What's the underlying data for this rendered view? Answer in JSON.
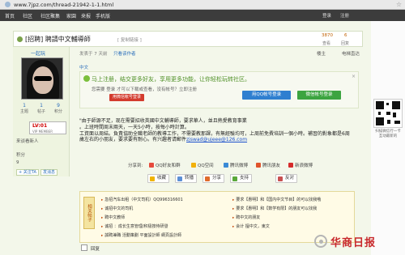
{
  "browser": {
    "url": "www.7jpz.com/thread-21942-1-1.html"
  },
  "sitenav": {
    "items": [
      "首页",
      "社区",
      "社区聚集",
      "家園",
      "来报",
      "手机版"
    ],
    "right": [
      "登录",
      "注册"
    ]
  },
  "thread": {
    "title": "[招聘] 聘請中文輔導師",
    "subtitle": "[ 复制链接 ]",
    "stats": [
      {
        "value": "3870",
        "label": "查看"
      },
      {
        "value": "6",
        "label": "回复"
      }
    ]
  },
  "user": {
    "name": "一起玩",
    "stats": [
      {
        "value": "1",
        "label": "主题"
      },
      {
        "value": "1",
        "label": "帖子"
      },
      {
        "value": "9",
        "label": "积分"
      }
    ],
    "level": "LV:01",
    "vip": "VIP MEMBER",
    "title": "来谈看新人",
    "credit_label": "积分",
    "credit_value": "9",
    "follow": "+ 关注TA",
    "message": "发消息"
  },
  "post": {
    "meta": "发表于 7 天前",
    "only_author": "只看该作者",
    "floor": "楼主",
    "tools": "电梯直达",
    "lang_tag": "中文",
    "notice_title": "马上注册，结交更多好友，享用更多功能，让你轻松玩转社区。",
    "notice_line": "您需要 登录 才可以下载或查看，没有帐号？立即注册",
    "register_btn": "用微信帐号登录",
    "qq_btn": "用QQ帐号登录",
    "wechat_btn": "微信帐号登录",
    "body_lines": [
      "\"由于師源不足，现在需要招收英國中文輔導師，要求華人，並且熱愛教育事業",
      "。上班時間周末兩天，一天5小時，按每小時計算。",
      "工資面以周結。負責協助全職老師的教導工作，不需要教那課，有無經驗均可，上周前免費培訓一個小時。補習的對象都是6周",
      "歲左右的小朋友，要求要有耐心。有兴趣者请郵件"
    ],
    "email": "zjswad@ujeee@126.com",
    "share_label": "分享到:",
    "share_items": [
      "QQ好友和群",
      "QQ空间",
      "腾讯微博",
      "腾讯朋友",
      "新浪微博"
    ],
    "actions": [
      "收藏",
      "转播",
      "分享",
      "支持",
      "反对"
    ]
  },
  "infobox": {
    "badge": "相关帖子",
    "left_items": [
      "急招汽车出租（中文司机）QQ996316601",
      "诚招中文的司机",
      "聘中文教师",
      "诚招 ：成长生意管理/积极按待研發",
      "誠聘兼職 活動策劃 平面設計師 網頁設計師"
    ],
    "right_items": [
      "要求【惠明】和【国内中文节目】的可以找我哦",
      "要求【惠明】和【数学有限】的朋友可以找我",
      "聘中文的朋友",
      "会计 擅中文，東文"
    ]
  },
  "reply": {
    "label": "回复",
    "right": "使用道具  举报"
  },
  "side": {
    "qr_label": "扫描微信行一卡 互动最新的"
  },
  "watermark": {
    "text": "华商日报"
  }
}
